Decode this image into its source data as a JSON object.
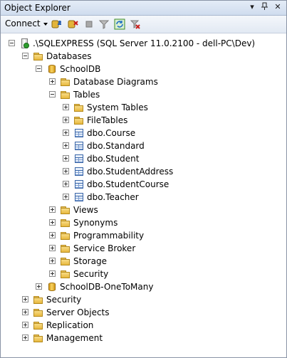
{
  "window": {
    "title": "Object Explorer",
    "pin_glyph": "▾ ╢ ✕"
  },
  "toolbar": {
    "connect_label": "Connect",
    "icons": [
      "connect-db-icon",
      "disconnect-icon",
      "stop-icon",
      "filter-icon",
      "refresh-icon",
      "close-filter-icon"
    ]
  },
  "tree": [
    {
      "label": ".\\SQLEXPRESS (SQL Server 11.0.2100 - dell-PC\\Dev)",
      "icon": "server-icon",
      "level": 0,
      "expander": "minus"
    },
    {
      "label": "Databases",
      "icon": "folder-icon",
      "level": 1,
      "expander": "minus"
    },
    {
      "label": "SchoolDB",
      "icon": "database-icon",
      "level": 2,
      "expander": "minus"
    },
    {
      "label": "Database Diagrams",
      "icon": "folder-icon",
      "level": 3,
      "expander": "plus"
    },
    {
      "label": "Tables",
      "icon": "folder-icon",
      "level": 3,
      "expander": "minus"
    },
    {
      "label": "System Tables",
      "icon": "folder-icon",
      "level": 4,
      "expander": "plus"
    },
    {
      "label": "FileTables",
      "icon": "folder-icon",
      "level": 4,
      "expander": "plus"
    },
    {
      "label": "dbo.Course",
      "icon": "table-icon",
      "level": 4,
      "expander": "plus"
    },
    {
      "label": "dbo.Standard",
      "icon": "table-icon",
      "level": 4,
      "expander": "plus"
    },
    {
      "label": "dbo.Student",
      "icon": "table-icon",
      "level": 4,
      "expander": "plus"
    },
    {
      "label": "dbo.StudentAddress",
      "icon": "table-icon",
      "level": 4,
      "expander": "plus"
    },
    {
      "label": "dbo.StudentCourse",
      "icon": "table-icon",
      "level": 4,
      "expander": "plus"
    },
    {
      "label": "dbo.Teacher",
      "icon": "table-icon",
      "level": 4,
      "expander": "plus"
    },
    {
      "label": "Views",
      "icon": "folder-icon",
      "level": 3,
      "expander": "plus"
    },
    {
      "label": "Synonyms",
      "icon": "folder-icon",
      "level": 3,
      "expander": "plus"
    },
    {
      "label": "Programmability",
      "icon": "folder-icon",
      "level": 3,
      "expander": "plus"
    },
    {
      "label": "Service Broker",
      "icon": "folder-icon",
      "level": 3,
      "expander": "plus"
    },
    {
      "label": "Storage",
      "icon": "folder-icon",
      "level": 3,
      "expander": "plus"
    },
    {
      "label": "Security",
      "icon": "folder-icon",
      "level": 3,
      "expander": "plus"
    },
    {
      "label": "SchoolDB-OneToMany",
      "icon": "database-icon",
      "level": 2,
      "expander": "plus"
    },
    {
      "label": "Security",
      "icon": "folder-icon",
      "level": 1,
      "expander": "plus"
    },
    {
      "label": "Server Objects",
      "icon": "folder-icon",
      "level": 1,
      "expander": "plus"
    },
    {
      "label": "Replication",
      "icon": "folder-icon",
      "level": 1,
      "expander": "plus"
    },
    {
      "label": "Management",
      "icon": "folder-icon",
      "level": 1,
      "expander": "plus"
    }
  ]
}
